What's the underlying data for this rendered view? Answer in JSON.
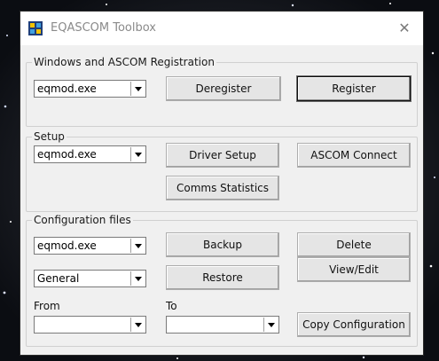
{
  "window": {
    "title": "EQASCOM Toolbox",
    "close_glyph": "✕"
  },
  "registration": {
    "legend": "Windows and ASCOM Registration",
    "driver_select": "eqmod.exe",
    "deregister_label": "Deregister",
    "register_label": "Register"
  },
  "setup": {
    "legend": "Setup",
    "driver_select": "eqmod.exe",
    "driver_setup_label": "Driver Setup",
    "ascom_connect_label": "ASCOM Connect",
    "comms_statistics_label": "Comms Statistics"
  },
  "config": {
    "legend": "Configuration files",
    "driver_select": "eqmod.exe",
    "section_select": "General",
    "backup_label": "Backup",
    "restore_label": "Restore",
    "delete_label": "Delete",
    "view_edit_label": "View/Edit",
    "from_label": "From",
    "to_label": "To",
    "from_select": "",
    "to_select": "",
    "copy_label": "Copy Configuration"
  },
  "colors": {
    "window_bg": "#f0f0f0",
    "titlebar_bg": "#ffffff",
    "background": "#0d0f14"
  }
}
